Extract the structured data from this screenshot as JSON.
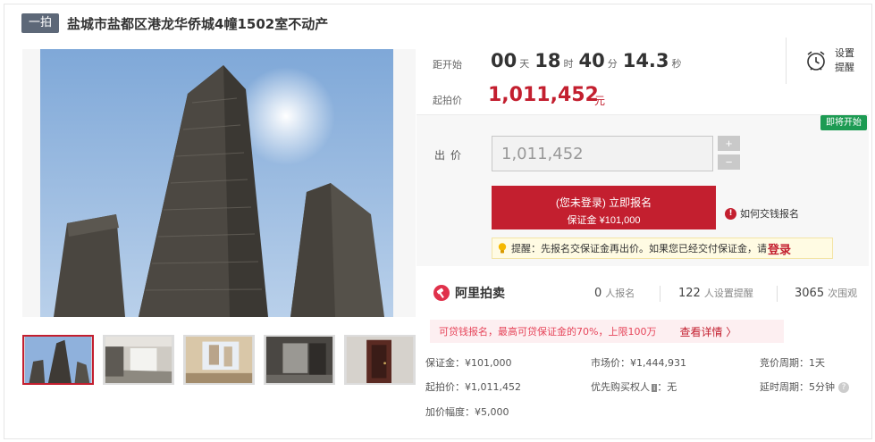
{
  "header": {
    "badge": "一拍",
    "title": "盐城市盐都区港龙华侨城4幢1502室不动产"
  },
  "gallery": {
    "thumbnails": [
      "thumb-1",
      "thumb-2",
      "thumb-3",
      "thumb-4",
      "thumb-5"
    ],
    "selected_index": 0
  },
  "countdown": {
    "label": "距开始",
    "days": "00",
    "days_unit": "天",
    "hours": "18",
    "hours_unit": "时",
    "minutes": "40",
    "minutes_unit": "分",
    "seconds": "14.3",
    "seconds_unit": "秒"
  },
  "price": {
    "label": "起拍价",
    "value": "1,011,452",
    "unit": "元"
  },
  "reminder": {
    "line1": "设置",
    "line2": "提醒",
    "icon": "alarm-clock-icon"
  },
  "bid": {
    "status_tag": "即将开始",
    "label": "出价",
    "input_value": "1,011,452",
    "plus": "+",
    "minus": "−",
    "signup_main": "(您未登录) 立即报名",
    "signup_sub": "保证金 ¥101,000",
    "how_pay": "如何交钱报名",
    "tip_text": "提醒：先报名交保证金再出价。如果您已经交付保证金，请",
    "tip_login": "登录"
  },
  "stats": {
    "brand": "阿里拍卖",
    "signups_value": "0",
    "signups_label": "人报名",
    "reminders_value": "122",
    "reminders_label": "人设置提醒",
    "views_value": "3065",
    "views_label": "次围观"
  },
  "promo": {
    "text": "可贷钱报名，最高可贷保证金的70%，上限100万",
    "link": "查看详情 〉"
  },
  "details": {
    "deposit": "保证金：¥101,000",
    "market_price": "市场价：¥1,444,931",
    "bid_period": "竞价周期：1天",
    "start_price": "起拍价：¥1,011,452",
    "priority_buyer_label": "优先购买权人",
    "priority_badge": "i",
    "priority_buyer_value": "：无",
    "extension": "延时周期：5分钟",
    "help": "?",
    "increment": "加价幅度：¥5,000"
  },
  "colors": {
    "accent": "#c31f2f",
    "badge": "#5d6878",
    "status_green": "#1d9b53",
    "promo_bg": "#fdeff1",
    "tip_bg": "#fffbe3"
  }
}
